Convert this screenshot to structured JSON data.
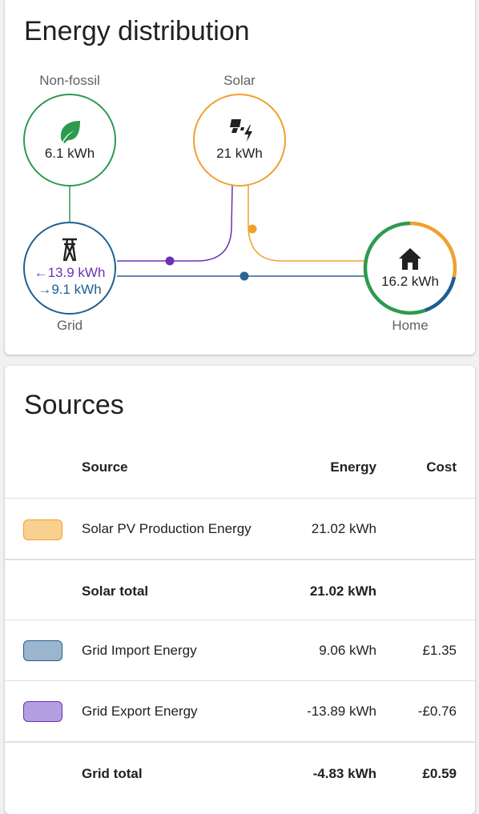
{
  "distribution": {
    "title": "Energy distribution",
    "nodes": {
      "nonfossil": {
        "label": "Non-fossil",
        "value": "6.1 kWh",
        "color": "#2e9a4f"
      },
      "solar": {
        "label": "Solar",
        "value": "21 kWh",
        "color": "#f0a030"
      },
      "grid": {
        "label": "Grid",
        "import_value": "←13.9 kWh",
        "export_value": "→9.1 kWh",
        "color": "#1f5f8f"
      },
      "home": {
        "label": "Home",
        "value": "16.2 kWh"
      }
    },
    "colors": {
      "grid_return": "#6a32b5",
      "grid_consumption": "#2a6394",
      "solar": "#f0a030",
      "nonfossil": "#2e9a4f"
    }
  },
  "sources": {
    "title": "Sources",
    "headers": {
      "source": "Source",
      "energy": "Energy",
      "cost": "Cost"
    },
    "rows": [
      {
        "name": "Solar PV Production Energy",
        "energy": "21.02 kWh",
        "cost": "",
        "swatch_fill": "#f8d08f",
        "swatch_border": "#f0a030"
      },
      {
        "name": "Solar total",
        "energy": "21.02 kWh",
        "cost": "",
        "total": true
      },
      {
        "name": "Grid Import Energy",
        "energy": "9.06 kWh",
        "cost": "£1.35",
        "swatch_fill": "#9ab5cc",
        "swatch_border": "#1f5f8f"
      },
      {
        "name": "Grid Export Energy",
        "energy": "-13.89 kWh",
        "cost": "-£0.76",
        "swatch_fill": "#b59ee0",
        "swatch_border": "#6a32b5"
      },
      {
        "name": "Grid total",
        "energy": "-4.83 kWh",
        "cost": "£0.59",
        "total": true
      }
    ]
  }
}
